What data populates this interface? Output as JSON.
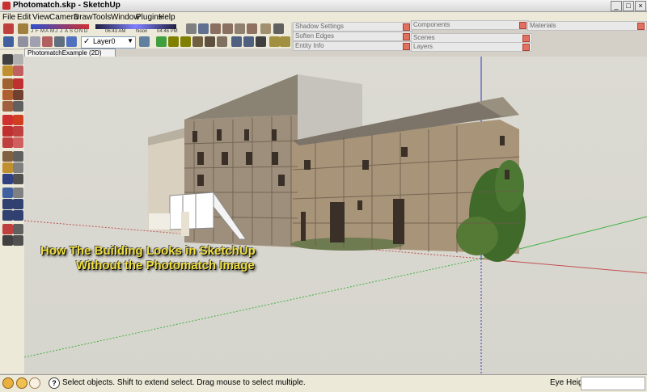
{
  "window": {
    "title": "Photomatch.skp - SketchUp"
  },
  "menu": [
    "File",
    "Edit",
    "View",
    "Camera",
    "Draw",
    "Tools",
    "Window",
    "Plugins",
    "Help"
  ],
  "shadow_bar": {
    "months": [
      "J",
      "F",
      "M",
      "A",
      "M",
      "J",
      "J",
      "A",
      "S",
      "O",
      "N",
      "D"
    ],
    "time_start": "06:43 AM",
    "time_noon": "Noon",
    "time_end": "04:46 PM"
  },
  "layer_select": {
    "value": "Layer0"
  },
  "trays": {
    "shadow_settings": "Shadow Settings",
    "soften_edges": "Soften Edges",
    "entity_info": "Entity Info",
    "components": "Components",
    "scenes": "Scenes",
    "layers": "Layers",
    "materials": "Materials"
  },
  "scene_tab": "PhotomatchExample (2D)",
  "caption": {
    "line1": "How The Building Looks in SketchUp",
    "line2": "Without the Photomatch Image"
  },
  "status": {
    "message": "Select objects. Shift to extend select. Drag mouse to select multiple.",
    "measure_label": "Eye Height"
  },
  "colors": {
    "red_axis": "#c05050",
    "green_axis": "#40b040",
    "blue_axis": "#3030c0",
    "caption": "#f0e040"
  }
}
